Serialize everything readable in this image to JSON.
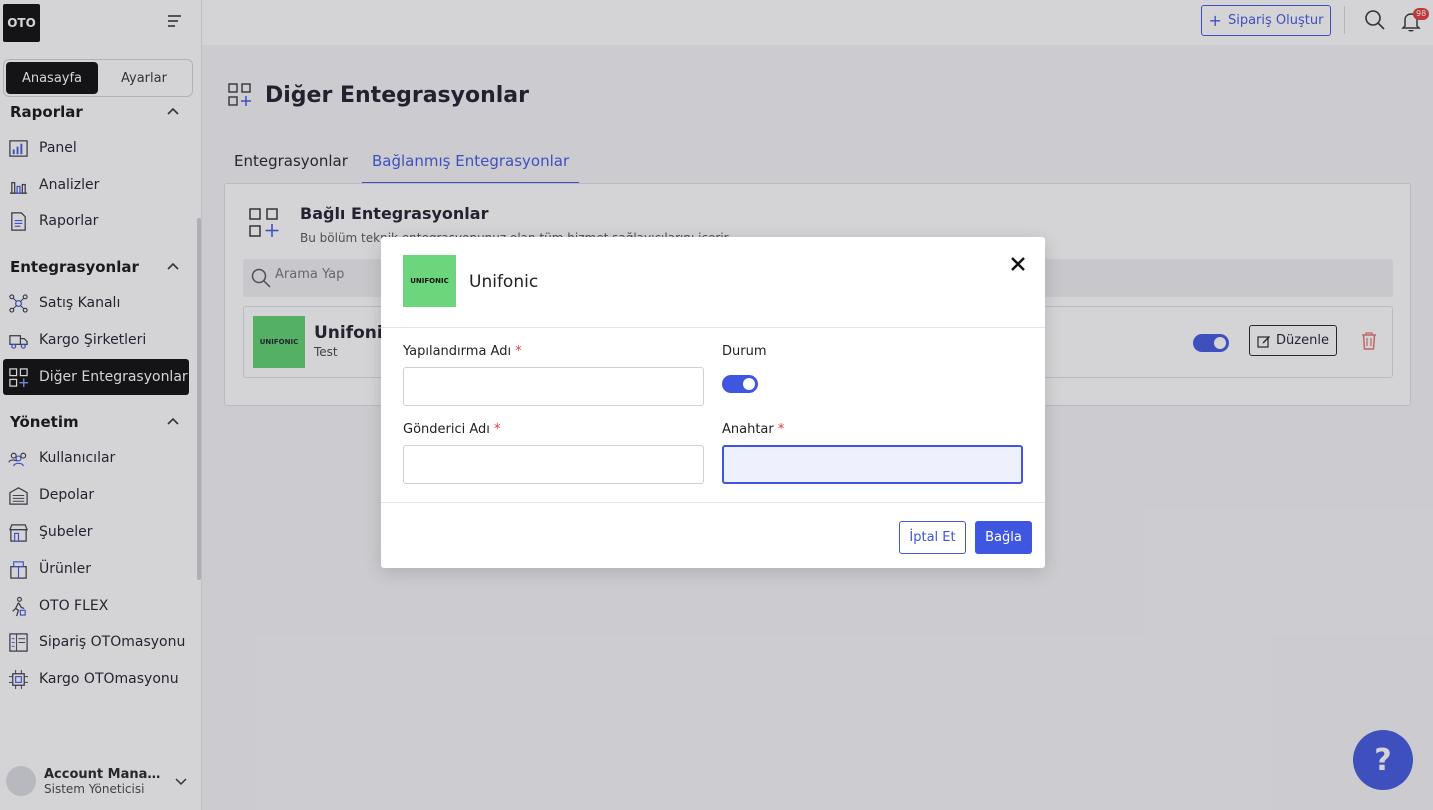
{
  "sidebar": {
    "logo": "OTO",
    "segment": {
      "home": "Anasayfa",
      "settings": "Ayarlar"
    },
    "sections": [
      {
        "title": "Raporlar",
        "items": [
          {
            "label": "Panel"
          },
          {
            "label": "Analizler"
          },
          {
            "label": "Raporlar"
          }
        ]
      },
      {
        "title": "Entegrasyonlar",
        "items": [
          {
            "label": "Satış Kanalı"
          },
          {
            "label": "Kargo Şirketleri"
          },
          {
            "label": "Diğer Entegrasyonlar"
          }
        ]
      },
      {
        "title": "Yönetim",
        "items": [
          {
            "label": "Kullanıcılar"
          },
          {
            "label": "Depolar"
          },
          {
            "label": "Şubeler"
          },
          {
            "label": "Ürünler"
          },
          {
            "label": "OTO FLEX"
          },
          {
            "label": "Sipariş OTOmasyonu"
          },
          {
            "label": "Kargo OTOmasyonu"
          }
        ]
      }
    ],
    "account": {
      "name": "Account Manage...",
      "role": "Sistem Yöneticisi"
    }
  },
  "topbar": {
    "create_order": "Sipariş Oluştur",
    "notification_count": "98"
  },
  "page": {
    "title": "Diğer Entegrasyonlar",
    "tabs": [
      {
        "label": "Entegrasyonlar"
      },
      {
        "label": "Bağlanmış Entegrasyonlar"
      }
    ],
    "card": {
      "title": "Bağlı Entegrasyonlar",
      "subtitle": "Bu bölüm teknik entegrasyonunuz olan tüm hizmet sağlayıcılarını içerir.",
      "search_placeholder": "Arama Yap",
      "row": {
        "name": "Unifonic",
        "sub": "Test",
        "logo_text": "UNIFONIC",
        "edit": "Düzenle"
      }
    },
    "help": "?"
  },
  "modal": {
    "title": "Unifonic",
    "logo_text": "UNIFONIC",
    "fields": {
      "config_name": {
        "label": "Yapılandırma Adı",
        "value": ""
      },
      "status": {
        "label": "Durum",
        "on": true
      },
      "sender_name": {
        "label": "Gönderici Adı",
        "value": ""
      },
      "key": {
        "label": "Anahtar",
        "value": ""
      }
    },
    "required_mark": "*",
    "cancel": "İptal Et",
    "connect": "Bağla"
  },
  "colors": {
    "accent": "#3f56e0",
    "required": "#e53935",
    "logo_green": "#6bd67c"
  }
}
